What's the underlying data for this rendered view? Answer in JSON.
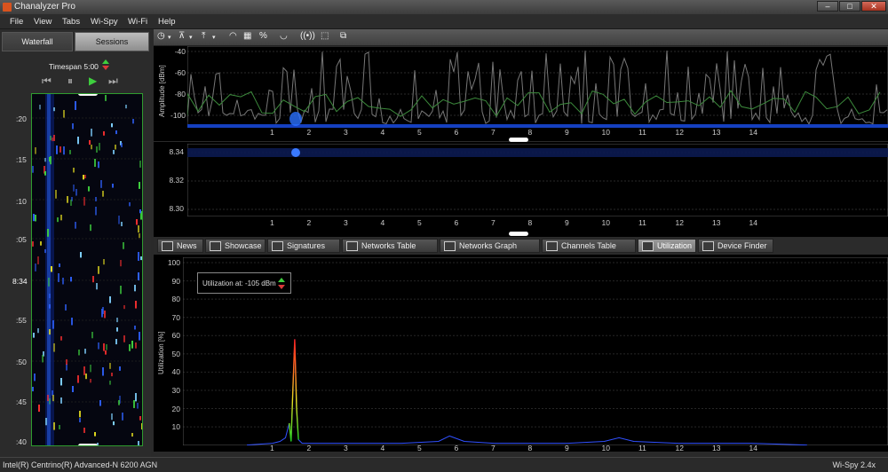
{
  "window": {
    "title": "Chanalyzer Pro"
  },
  "menu": [
    "File",
    "View",
    "Tabs",
    "Wi-Spy",
    "Wi-Fi",
    "Help"
  ],
  "left_panel": {
    "tabs": [
      {
        "label": "Waterfall",
        "active": true
      },
      {
        "label": "Sessions",
        "active": false
      }
    ],
    "timespan_label": "Timespan 5:00",
    "waterfall_labels": [
      ":20",
      ":15",
      ":10",
      ":05",
      "8:34",
      ":55",
      ":50",
      ":45",
      ":40"
    ]
  },
  "toolbar": {
    "percent_label": "%"
  },
  "amplitude": {
    "axis_title": "Amplitude [dBm]",
    "y_ticks": [
      "-40",
      "-60",
      "-80",
      "-100"
    ],
    "x_ticks": [
      "1",
      "2",
      "3",
      "4",
      "5",
      "6",
      "7",
      "8",
      "9",
      "10",
      "11",
      "12",
      "13",
      "14"
    ]
  },
  "timeline": {
    "y_ticks": [
      "8.34",
      "8.32",
      "8.30"
    ],
    "x_ticks": [
      "1",
      "2",
      "3",
      "4",
      "5",
      "6",
      "7",
      "8",
      "9",
      "10",
      "11",
      "12",
      "13",
      "14"
    ]
  },
  "tabs": [
    {
      "label": "News",
      "icon": "table-icon"
    },
    {
      "label": "Showcase",
      "icon": "play-icon"
    },
    {
      "label": "Signatures",
      "icon": "radar-icon"
    },
    {
      "label": "Networks Table",
      "icon": "wifi-icon"
    },
    {
      "label": "Networks Graph",
      "icon": "wave-icon"
    },
    {
      "label": "Channels Table",
      "icon": "list-icon"
    },
    {
      "label": "Utilization",
      "icon": "percent-icon",
      "active": true
    },
    {
      "label": "Device Finder",
      "icon": "finder-icon"
    }
  ],
  "utilization": {
    "axis_title": "Utilization [%]",
    "box_label": "Utilization at:  -105 dBm",
    "y_ticks": [
      "100",
      "90",
      "80",
      "70",
      "60",
      "50",
      "40",
      "30",
      "20",
      "10"
    ],
    "x_ticks": [
      "1",
      "2",
      "3",
      "4",
      "5",
      "6",
      "7",
      "8",
      "9",
      "10",
      "11",
      "12",
      "13",
      "14"
    ]
  },
  "chart_data": {
    "type": "line",
    "xlabel": "",
    "ylabel": "Utilization [%]",
    "xlim": [
      0.3,
      15.5
    ],
    "ylim": [
      0,
      100
    ],
    "series": [
      {
        "x": [
          0.3,
          1.0,
          1.2,
          1.35,
          1.45,
          1.5,
          1.55,
          1.6,
          1.65,
          1.7,
          1.8,
          2.5,
          3.5,
          4.5,
          5.5,
          5.8,
          6.2,
          7.0,
          8.0,
          9.0,
          10.0,
          10.4,
          10.8,
          12.0,
          13.0,
          14.0,
          15.5
        ],
        "y": [
          0,
          1,
          2,
          4,
          12,
          2,
          30,
          58,
          20,
          3,
          1,
          1,
          1,
          1,
          2,
          5,
          2,
          1,
          1,
          1,
          2,
          4,
          2,
          1,
          1,
          1,
          0
        ]
      }
    ],
    "colors": {
      "peak_high": "#ff2020",
      "peak_mid": "#e8e020",
      "peak_low": "#20d020",
      "baseline": "#3050ff"
    }
  },
  "status": {
    "left": "Intel(R) Centrino(R) Advanced-N 6200 AGN",
    "right": "Wi-Spy 2.4x"
  }
}
